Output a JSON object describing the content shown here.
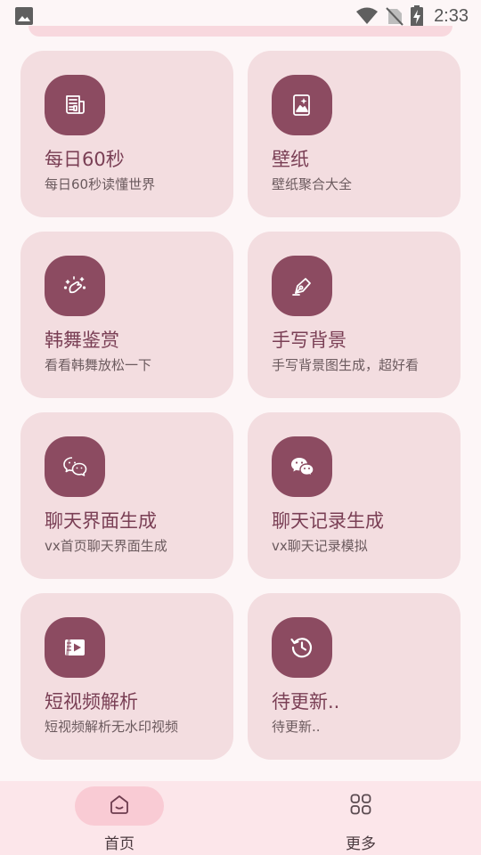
{
  "status_bar": {
    "time": "2:33"
  },
  "cards": [
    {
      "title": "每日60秒",
      "subtitle": "每日60秒读懂世界",
      "icon": "newspaper-icon"
    },
    {
      "title": "壁纸",
      "subtitle": "壁纸聚合大全",
      "icon": "wallpaper-icon"
    },
    {
      "title": "韩舞鉴赏",
      "subtitle": "看看韩舞放松一下",
      "icon": "sparkle-hand-icon"
    },
    {
      "title": "手写背景",
      "subtitle": "手写背景图生成，超好看",
      "icon": "pen-icon"
    },
    {
      "title": "聊天界面生成",
      "subtitle": "vx首页聊天界面生成",
      "icon": "wechat-outline-icon"
    },
    {
      "title": "聊天记录生成",
      "subtitle": "vx聊天记录模拟",
      "icon": "wechat-filled-icon"
    },
    {
      "title": "短视频解析",
      "subtitle": "短视频解析无水印视频",
      "icon": "video-icon"
    },
    {
      "title": "待更新..",
      "subtitle": "待更新..",
      "icon": "history-icon"
    }
  ],
  "bottom_nav": {
    "items": [
      {
        "label": "首页",
        "icon": "home-icon",
        "active": true
      },
      {
        "label": "更多",
        "icon": "grid-icon",
        "active": false
      }
    ]
  },
  "colors": {
    "accent": "#8C4B61",
    "card_bg": "#F3DDE0",
    "nav_active": "#F9CBD4"
  }
}
